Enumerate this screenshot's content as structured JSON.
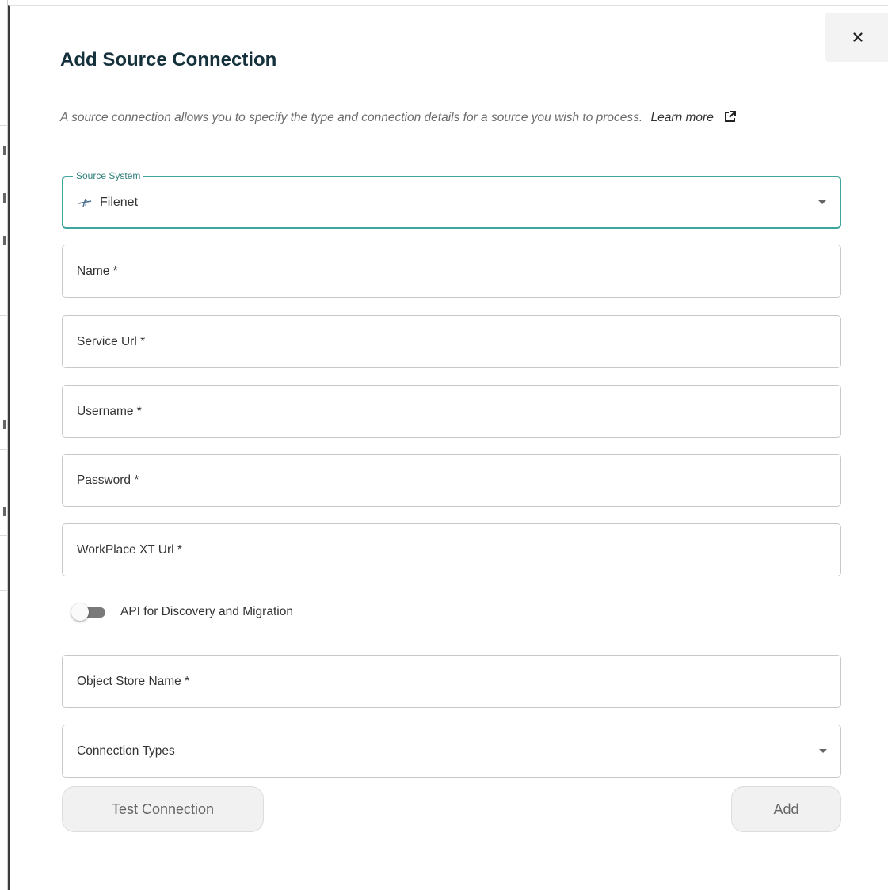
{
  "dialog": {
    "title": "Add Source Connection",
    "description": "A source connection allows you to specify the type and connection details for a source you wish to process.",
    "learn_more_label": "Learn more",
    "close_label": "×"
  },
  "source_system": {
    "legend": "Source System",
    "value": "Filenet",
    "icon": "filenet-logo-icon"
  },
  "fields": {
    "name": "Name *",
    "service_url": "Service Url *",
    "username": "Username *",
    "password": "Password *",
    "workplace_url": "WorkPlace XT Url *",
    "object_store": "Object Store Name *",
    "connection_types": "Connection Types"
  },
  "toggle": {
    "label": "API for Discovery and Migration",
    "on": false
  },
  "buttons": {
    "test_connection": "Test Connection",
    "add": "Add"
  },
  "colors": {
    "accent": "#3ea69c",
    "title": "#14313b",
    "button_bg": "#f1f1f1"
  }
}
